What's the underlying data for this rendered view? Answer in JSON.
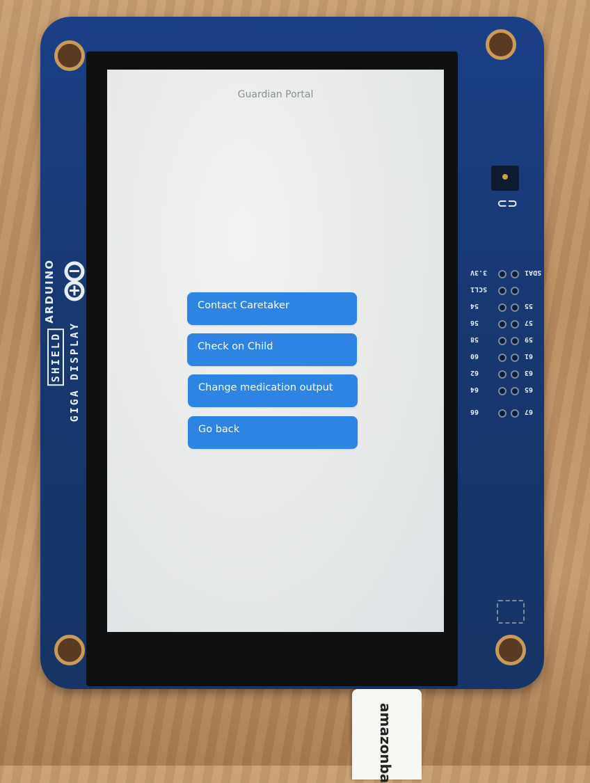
{
  "screen": {
    "title": "Guardian Portal",
    "buttons": [
      {
        "label": "Contact Caretaker"
      },
      {
        "label": "Check on Child"
      },
      {
        "label": "Change medication output"
      },
      {
        "label": "Go back"
      }
    ],
    "accent_color": "#2d84e3"
  },
  "device": {
    "brand": "ARDUINO",
    "product_line1": "GIGA DISPLAY",
    "product_line2": "SHIELD",
    "pin_labels": [
      {
        "left": "3.3V",
        "right": "SDA1"
      },
      {
        "left": "SCL1",
        "right": ""
      },
      {
        "left": "54",
        "right": "55"
      },
      {
        "left": "56",
        "right": "57"
      },
      {
        "left": "58",
        "right": "59"
      },
      {
        "left": "60",
        "right": "61"
      },
      {
        "left": "62",
        "right": "63"
      },
      {
        "left": "64",
        "right": "65"
      },
      {
        "left": "66",
        "right": "67"
      }
    ],
    "cable_label": "amazonba"
  }
}
